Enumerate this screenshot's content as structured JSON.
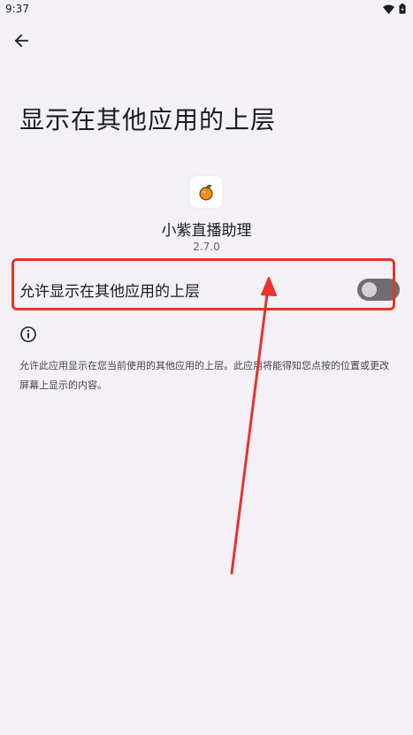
{
  "status_bar": {
    "time": "9:37"
  },
  "header": {
    "back_icon": "arrow-back-icon"
  },
  "page": {
    "title": "显示在其他应用的上层"
  },
  "app": {
    "name": "小紫直播助理",
    "version": "2.7.0",
    "icon": "orange-fruit-icon"
  },
  "setting": {
    "label": "允许显示在其他应用的上层",
    "enabled": false
  },
  "info": {
    "icon": "info-icon",
    "description": "允许此应用显示在您当前使用的其他应用的上层。此应用将能得知您点按的位置或更改屏幕上显示的内容。"
  },
  "colors": {
    "annotation": "#e8322a",
    "background": "#f3f1f5",
    "toggle_track_off": "#6f6c74"
  }
}
